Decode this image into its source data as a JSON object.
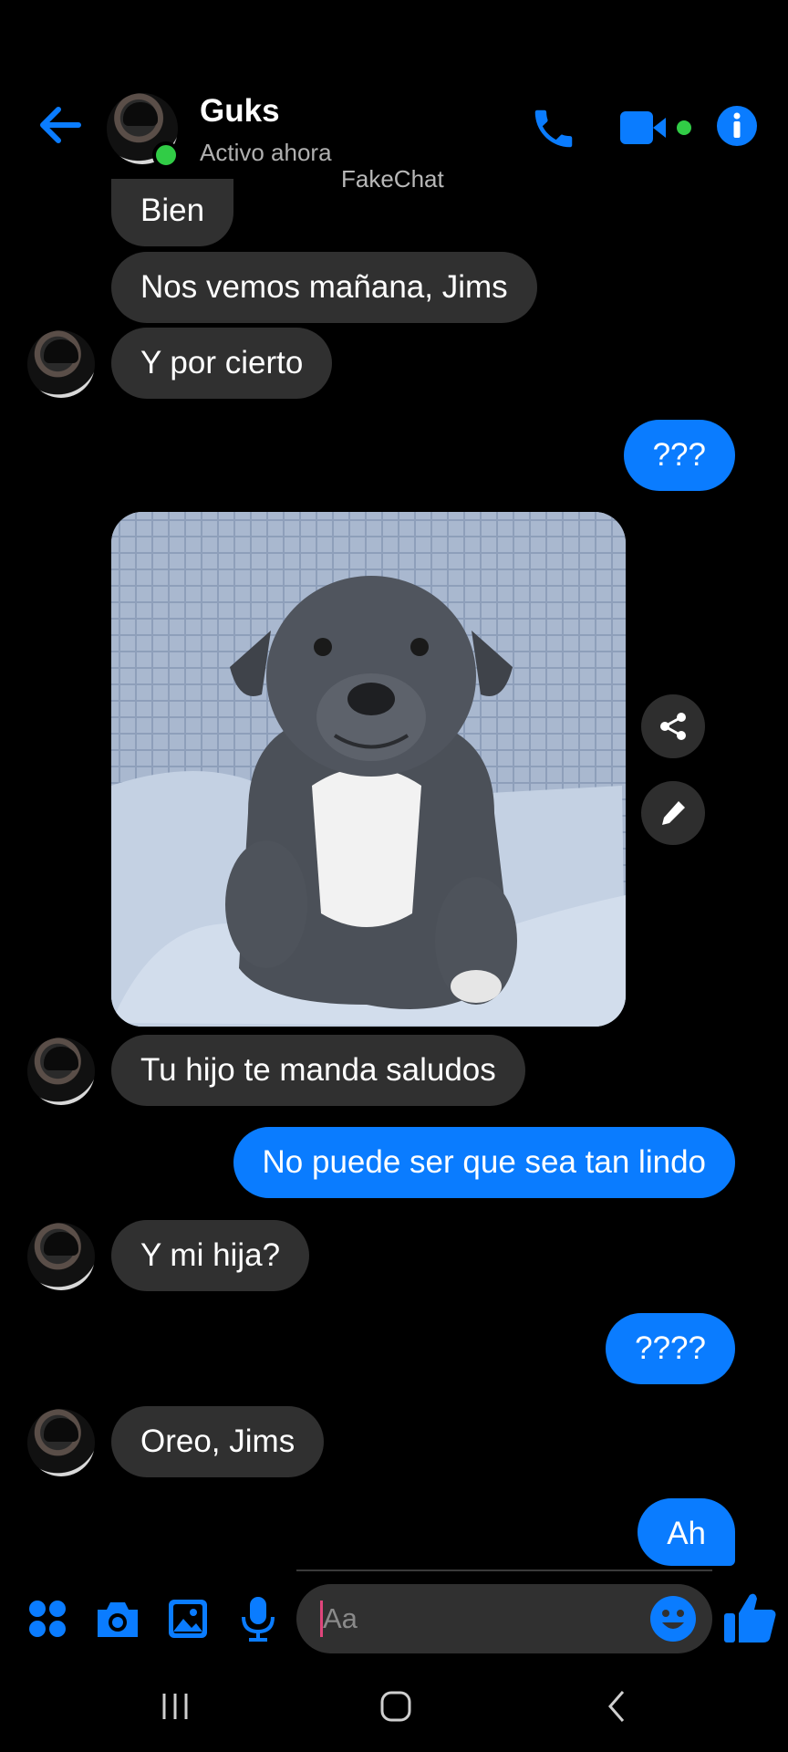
{
  "header": {
    "contact_name": "Guks",
    "status": "Activo ahora",
    "watermark": "FakeChat"
  },
  "messages": [
    {
      "direction": "in",
      "text": "Bien"
    },
    {
      "direction": "in",
      "text": "Nos vemos mañana, Jims"
    },
    {
      "direction": "in",
      "text": "Y por cierto"
    },
    {
      "direction": "out",
      "text": "???"
    },
    {
      "direction": "in",
      "type": "image",
      "description": "dog"
    },
    {
      "direction": "in",
      "text": "Tu hijo te manda saludos"
    },
    {
      "direction": "out",
      "text": "No puede ser que sea tan lindo"
    },
    {
      "direction": "in",
      "text": "Y mi hija?"
    },
    {
      "direction": "out",
      "text": "????"
    },
    {
      "direction": "in",
      "text": "Oreo, Jims"
    },
    {
      "direction": "out",
      "text": "Ah"
    }
  ],
  "composer": {
    "placeholder": "Aa"
  },
  "icons": {
    "back": "back-arrow-icon",
    "call": "phone-icon",
    "video": "video-camera-icon",
    "info": "info-icon",
    "apps": "apps-grid-icon",
    "camera": "camera-icon",
    "gallery": "gallery-icon",
    "mic": "microphone-icon",
    "emoji": "emoji-icon",
    "like": "thumbs-up-icon",
    "share": "share-icon",
    "edit": "pencil-icon"
  },
  "colors": {
    "accent": "#0a7cff",
    "incoming_bubble": "#303030",
    "online": "#31cc46"
  }
}
